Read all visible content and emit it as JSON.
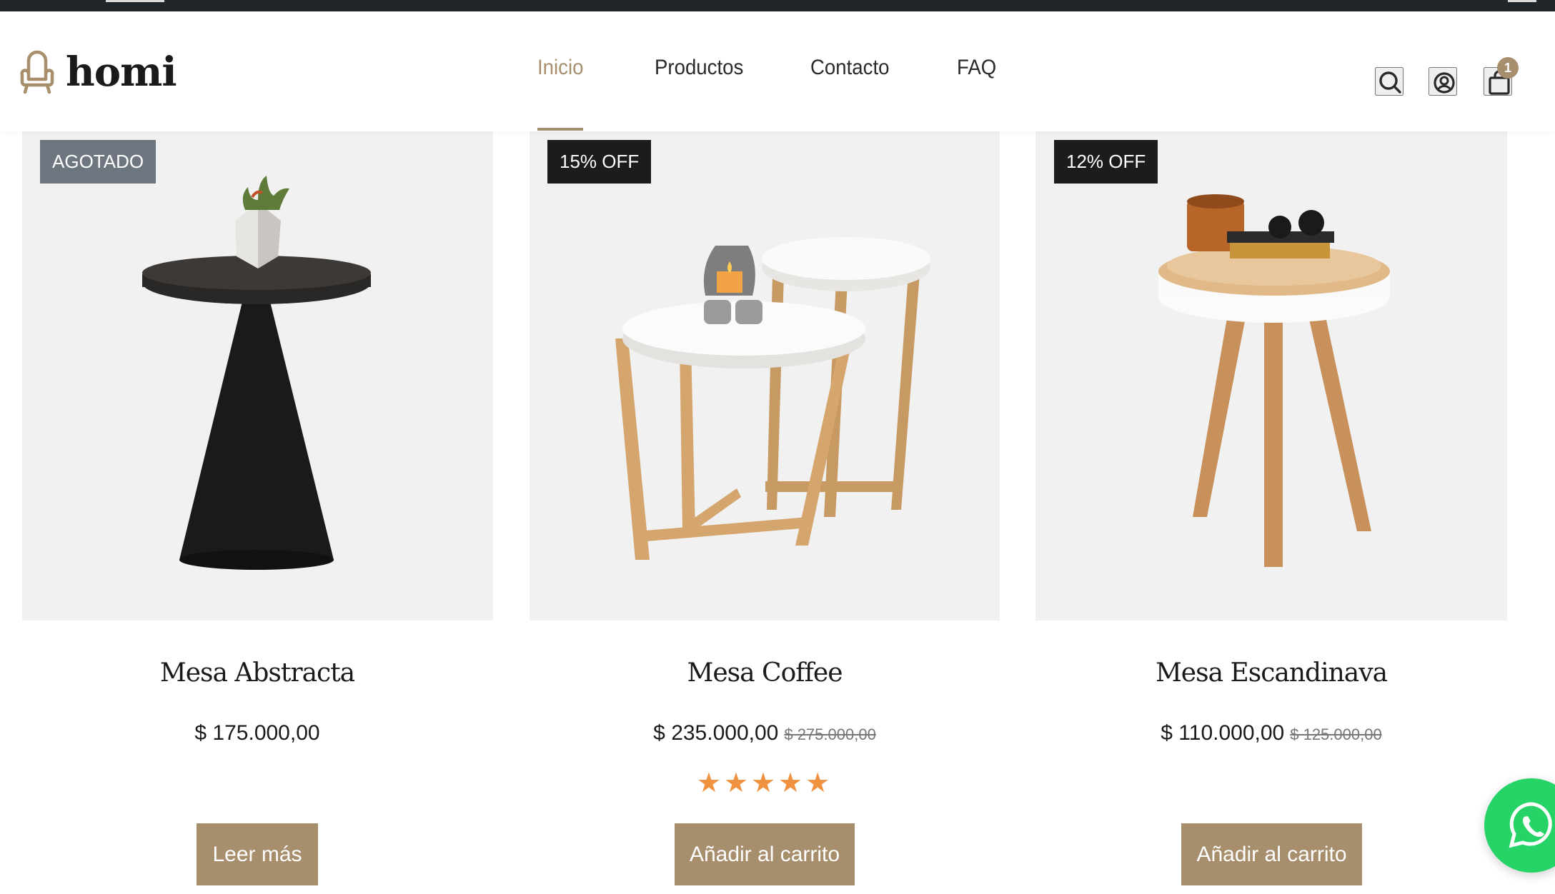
{
  "brand": {
    "name": "homi"
  },
  "nav": {
    "items": [
      {
        "label": "Inicio",
        "active": true
      },
      {
        "label": "Productos",
        "active": false
      },
      {
        "label": "Contacto",
        "active": false
      },
      {
        "label": "FAQ",
        "active": false
      }
    ]
  },
  "header_icons": [
    "search-icon",
    "user-icon",
    "cart-icon"
  ],
  "cart": {
    "count": "1"
  },
  "products": [
    {
      "badge": "AGOTADO",
      "badge_style": "grey",
      "name": "Mesa Abstracta",
      "price": "$ 175.000,00",
      "old_price": "",
      "rating": "",
      "cta": "Leer más"
    },
    {
      "badge": "15% OFF",
      "badge_style": "dark",
      "name": "Mesa Coffee",
      "price": "$ 235.000,00",
      "old_price": "$ 275.000,00",
      "rating": "★★★★★",
      "cta": "Añadir al carrito"
    },
    {
      "badge": "12% OFF",
      "badge_style": "dark",
      "name": "Mesa Escandinava",
      "price": "$ 110.000,00",
      "old_price": "$ 125.000,00",
      "rating": "",
      "cta": "Añadir al carrito"
    }
  ],
  "colors": {
    "accent": "#a78e6c",
    "star": "#f0913f",
    "badge_dark": "#1c1c1c",
    "badge_grey": "#6d767e",
    "whatsapp": "#25d366",
    "card_bg": "#f1f1f1"
  },
  "floating": {
    "icon": "whatsapp-icon"
  }
}
